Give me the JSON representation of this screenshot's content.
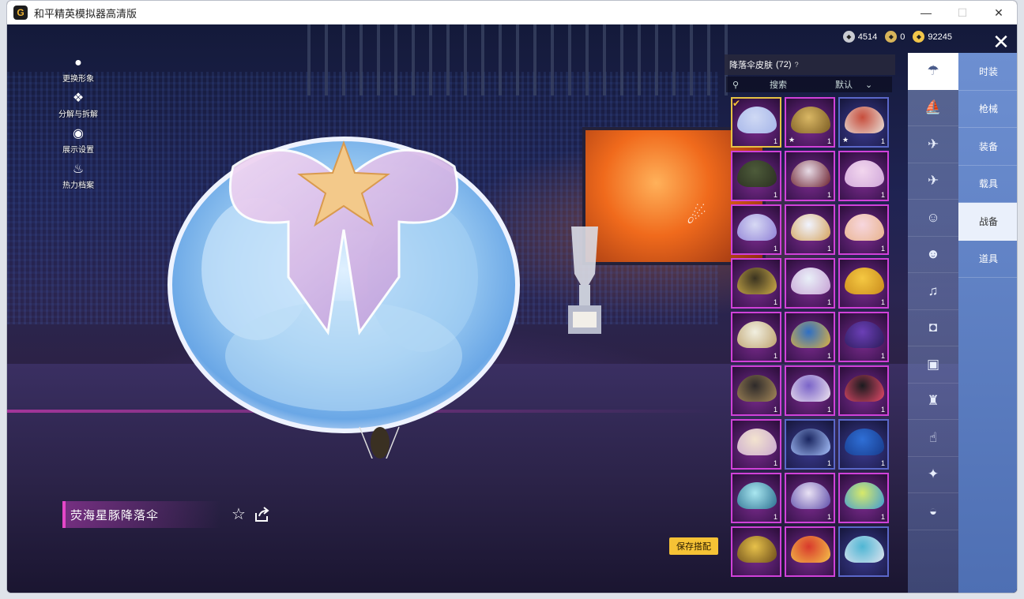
{
  "window": {
    "title": "和平精英模拟器高清版",
    "controls": {
      "minimize": "—",
      "maximize": "☐",
      "close": "✕"
    }
  },
  "currency": [
    {
      "icon": "silver-coin-icon",
      "value": "4514",
      "color": "#c9cbd2"
    },
    {
      "icon": "medal-coin-icon",
      "value": "0",
      "color": "#d7b45a"
    },
    {
      "icon": "gold-coin-icon",
      "value": "92245",
      "color": "#f2c64a"
    }
  ],
  "close_label": "✕",
  "left_menu": [
    {
      "icon": "person-icon",
      "label": "更换形象"
    },
    {
      "icon": "puzzle-icon",
      "label": "分解与拆解"
    },
    {
      "icon": "eye-icon",
      "label": "展示设置"
    },
    {
      "icon": "flame-icon",
      "label": "热力档案"
    }
  ],
  "item": {
    "name": "荧海星豚降落伞",
    "save_label": "保存搭配"
  },
  "panel": {
    "title": "降落伞皮肤",
    "count": "(72)",
    "search_placeholder": "搜索",
    "sort_label": "默认"
  },
  "grid_items": [
    {
      "qty": "1",
      "colors": [
        "#cfd9f4",
        "#a4b4e8"
      ],
      "equipped": true,
      "star": false,
      "frame": "gold"
    },
    {
      "qty": "1",
      "colors": [
        "#d9b764",
        "#7a5b22"
      ],
      "equipped": false,
      "star": true,
      "frame": "purple"
    },
    {
      "qty": "1",
      "colors": [
        "#c74d3c",
        "#e8e2da"
      ],
      "equipped": false,
      "star": true,
      "frame": "blue"
    },
    {
      "qty": "1",
      "colors": [
        "#4d5b3a",
        "#2a2f20"
      ],
      "equipped": false,
      "star": false,
      "frame": "purple"
    },
    {
      "qty": "1",
      "colors": [
        "#e7dbe6",
        "#6a1e2c"
      ],
      "equipped": false,
      "star": false,
      "frame": "purple"
    },
    {
      "qty": "1",
      "colors": [
        "#f2d6ee",
        "#cfa6d9"
      ],
      "equipped": false,
      "star": false,
      "frame": "purple"
    },
    {
      "qty": "1",
      "colors": [
        "#d7d9f4",
        "#8e7fd6"
      ],
      "equipped": false,
      "star": false,
      "frame": "purple"
    },
    {
      "qty": "1",
      "colors": [
        "#f1f4ff",
        "#d4a15a"
      ],
      "equipped": false,
      "star": false,
      "frame": "purple"
    },
    {
      "qty": "1",
      "colors": [
        "#f7d6de",
        "#e8b38c"
      ],
      "equipped": false,
      "star": false,
      "frame": "purple"
    },
    {
      "qty": "1",
      "colors": [
        "#3a3320",
        "#d0ae4a"
      ],
      "equipped": false,
      "star": false,
      "frame": "purple"
    },
    {
      "qty": "1",
      "colors": [
        "#e9f0f8",
        "#c6a0d4"
      ],
      "equipped": false,
      "star": false,
      "frame": "purple"
    },
    {
      "qty": "1",
      "colors": [
        "#f5c842",
        "#c98b1c"
      ],
      "equipped": false,
      "star": false,
      "frame": "purple"
    },
    {
      "qty": "1",
      "colors": [
        "#f1efe0",
        "#bca06c"
      ],
      "equipped": false,
      "star": false,
      "frame": "purple"
    },
    {
      "qty": "1",
      "colors": [
        "#2f6fc4",
        "#e0b240"
      ],
      "equipped": false,
      "star": false,
      "frame": "purple"
    },
    {
      "qty": "1",
      "colors": [
        "#6b3fb6",
        "#2a1b58"
      ],
      "equipped": false,
      "star": false,
      "frame": "purple"
    },
    {
      "qty": "1",
      "colors": [
        "#2e2a2a",
        "#a78a5a"
      ],
      "equipped": false,
      "star": false,
      "frame": "purple"
    },
    {
      "qty": "1",
      "colors": [
        "#7a64c8",
        "#f1e6f0"
      ],
      "equipped": false,
      "star": false,
      "frame": "purple"
    },
    {
      "qty": "1",
      "colors": [
        "#1b1b1f",
        "#e74a6a"
      ],
      "equipped": false,
      "star": false,
      "frame": "purple"
    },
    {
      "qty": "1",
      "colors": [
        "#f3e3cf",
        "#c9a9cf"
      ],
      "equipped": false,
      "star": false,
      "frame": "purple"
    },
    {
      "qty": "1",
      "colors": [
        "#1a2660",
        "#aac4ff"
      ],
      "equipped": false,
      "star": false,
      "frame": "blue"
    },
    {
      "qty": "1",
      "colors": [
        "#2f6fd6",
        "#173a8a"
      ],
      "equipped": false,
      "star": false,
      "frame": "blue"
    },
    {
      "qty": "1",
      "colors": [
        "#a9e7f0",
        "#2a6e8f"
      ],
      "equipped": false,
      "star": false,
      "frame": "purple"
    },
    {
      "qty": "1",
      "colors": [
        "#e9e2f4",
        "#5c4aa8"
      ],
      "equipped": false,
      "star": false,
      "frame": "purple"
    },
    {
      "qty": "1",
      "colors": [
        "#d7e96a",
        "#3d9ad6"
      ],
      "equipped": false,
      "star": false,
      "frame": "purple"
    },
    {
      "qty": "",
      "colors": [
        "#e7c14a",
        "#6a4b1a"
      ],
      "equipped": false,
      "star": false,
      "frame": "purple"
    },
    {
      "qty": "",
      "colors": [
        "#d83a2c",
        "#f5c34a"
      ],
      "equipped": false,
      "star": false,
      "frame": "purple"
    },
    {
      "qty": "",
      "colors": [
        "#4fb6d4",
        "#e0e4ef"
      ],
      "equipped": false,
      "star": false,
      "frame": "blue"
    }
  ],
  "icon_rail": [
    {
      "icon": "parachute-icon",
      "active": true
    },
    {
      "icon": "boat-icon",
      "active": false
    },
    {
      "icon": "drone-icon",
      "active": false
    },
    {
      "icon": "airplane-icon",
      "active": false
    },
    {
      "icon": "emote-face-icon",
      "active": false
    },
    {
      "icon": "robot-icon",
      "active": false
    },
    {
      "icon": "speaker-icon",
      "active": false
    },
    {
      "icon": "gamepad-icon",
      "active": false
    },
    {
      "icon": "picture-frame-icon",
      "active": false
    },
    {
      "icon": "fire-extinguisher-icon",
      "active": false
    },
    {
      "icon": "hand-gesture-icon",
      "active": false
    },
    {
      "icon": "magic-wand-icon",
      "active": false
    },
    {
      "icon": "plate-icon",
      "active": false
    }
  ],
  "categories": [
    {
      "label": "时装",
      "active": false
    },
    {
      "label": "枪械",
      "active": false
    },
    {
      "label": "装备",
      "active": false
    },
    {
      "label": "载具",
      "active": false
    },
    {
      "label": "战备",
      "active": true
    },
    {
      "label": "道具",
      "active": false
    }
  ]
}
